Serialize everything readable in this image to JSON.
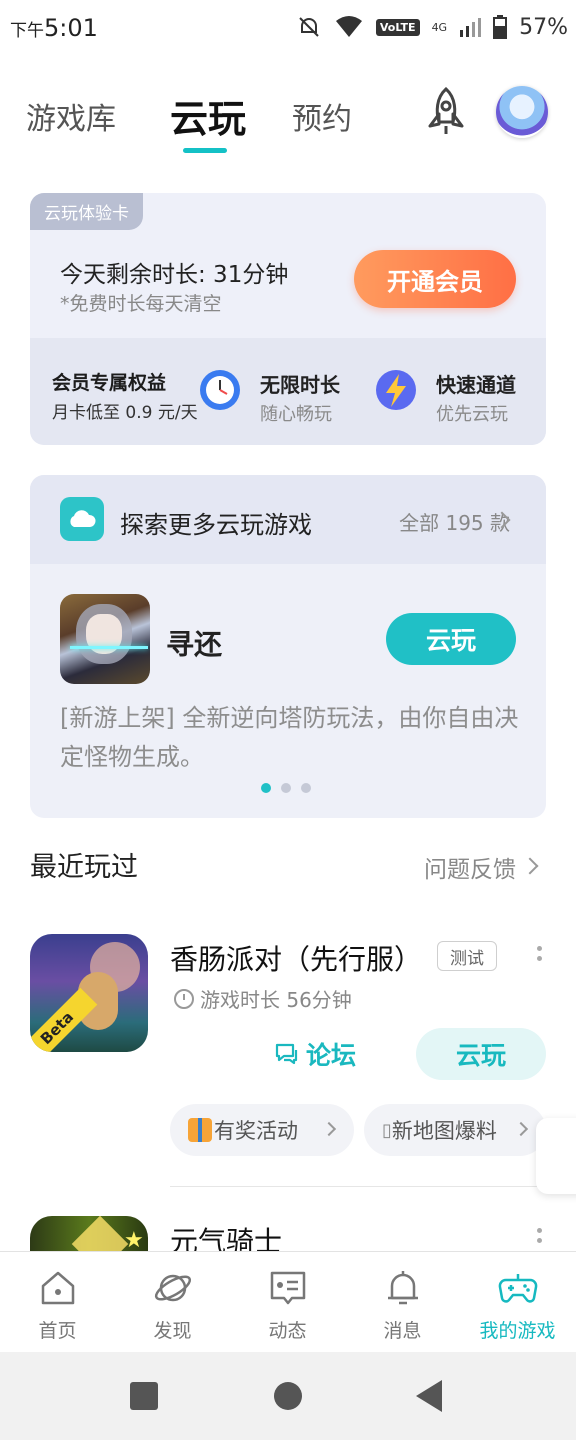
{
  "status_bar": {
    "ampm": "下午",
    "time": "5:01",
    "network": "4G",
    "volte": "VoLTE",
    "battery": "57%"
  },
  "top_tabs": [
    {
      "label": "游戏库"
    },
    {
      "label": "云玩"
    },
    {
      "label": "预约"
    }
  ],
  "active_tab": "云玩",
  "member_card": {
    "tag": "云玩体验卡",
    "remaining": "今天剩余时长: 31分钟",
    "note": "*免费时长每天清空",
    "open_button": "开通会员",
    "benefit_main": {
      "title": "会员专属权益",
      "sub": "月卡低至 0.9 元/天"
    },
    "benefits": [
      {
        "title": "无限时长",
        "sub": "随心畅玩",
        "icon": "clock-icon"
      },
      {
        "title": "快速通道",
        "sub": "优先云玩",
        "icon": "lightning-icon"
      }
    ]
  },
  "explore": {
    "title": "探索更多云玩游戏",
    "all_label": "全部 195 款",
    "game": {
      "name": "寻还",
      "button": "云玩",
      "desc": "[新游上架] 全新逆向塔防玩法，由你自由决定怪物生成。"
    },
    "carousel_pages": 3,
    "carousel_active": 0
  },
  "recent": {
    "title": "最近玩过",
    "feedback": "问题反馈",
    "games": [
      {
        "name": "香肠派对（先行服）",
        "badge": "测试",
        "icon_badge": "Beta",
        "playtime": "游戏时长 56分钟",
        "forum": "论坛",
        "cloud": "云玩",
        "chips": [
          "有奖活动",
          "新地图爆料"
        ]
      },
      {
        "name": "元气骑士"
      }
    ]
  },
  "bottom_nav": [
    {
      "label": "首页",
      "icon": "home-icon"
    },
    {
      "label": "发现",
      "icon": "planet-icon"
    },
    {
      "label": "动态",
      "icon": "chat-card-icon"
    },
    {
      "label": "消息",
      "icon": "bell-icon"
    },
    {
      "label": "我的游戏",
      "icon": "gamepad-icon"
    }
  ],
  "colors": {
    "accent": "#16b9c0",
    "orange": "#ff7a4a"
  }
}
